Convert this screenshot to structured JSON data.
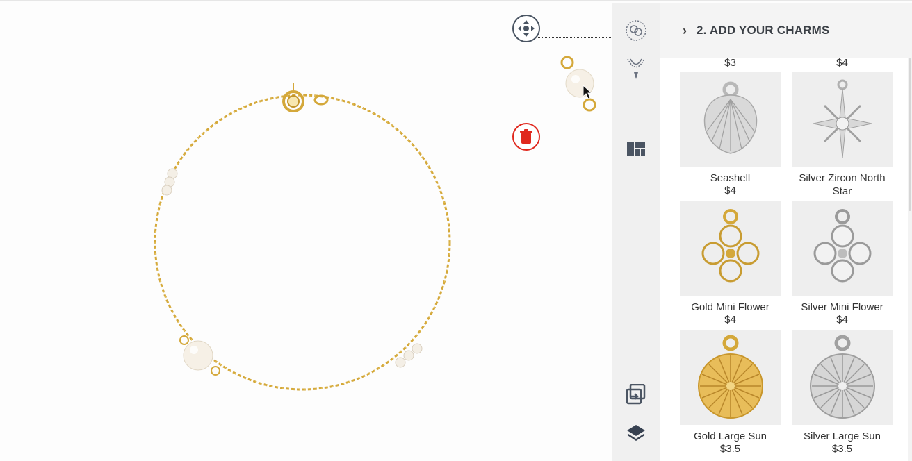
{
  "canvas": {
    "move_icon": "move-arrows-icon",
    "delete_icon": "trash-icon"
  },
  "rail": {
    "items": [
      "rings-icon",
      "necklace-icon",
      "layout-grid-icon",
      "export-icon",
      "layers-icon"
    ]
  },
  "panel": {
    "title": "2. ADD YOUR CHARMS",
    "top_prices": [
      "$3",
      "$4"
    ],
    "charms": [
      {
        "name": "Seashell",
        "price": "$4"
      },
      {
        "name": "Silver Zircon North Star",
        "price": ""
      },
      {
        "name": "Gold Mini Flower",
        "price": "$4"
      },
      {
        "name": "Silver Mini Flower",
        "price": "$4"
      },
      {
        "name": "Gold Large Sun",
        "price": "$3.5"
      },
      {
        "name": "Silver Large Sun",
        "price": "$3.5"
      }
    ]
  },
  "colors": {
    "gold": "#d4a83a",
    "silver": "#c8c8c8",
    "delete_red": "#e0281e",
    "header_text": "#3a3f45"
  }
}
